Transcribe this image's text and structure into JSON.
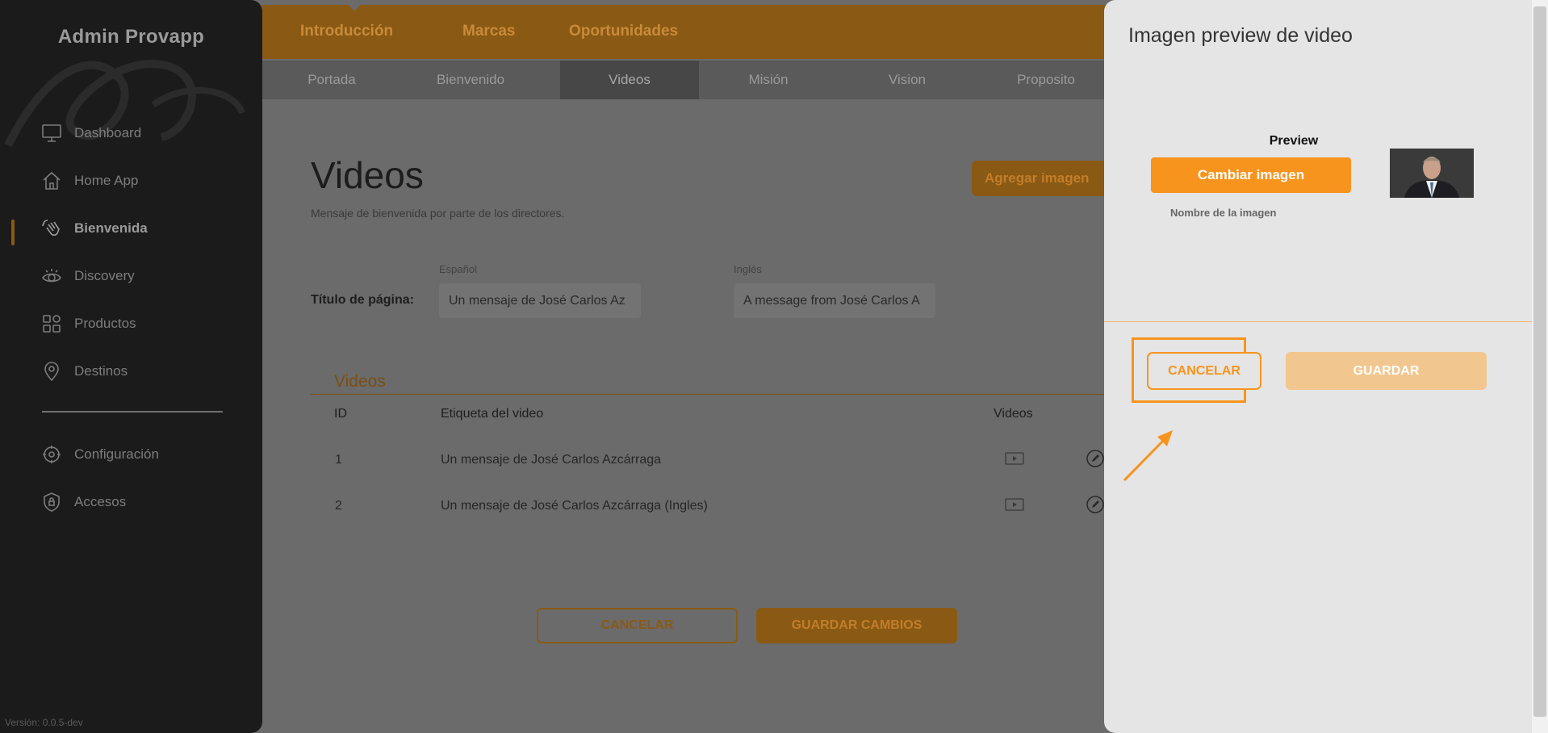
{
  "sidebar": {
    "brand": "Admin Provapp",
    "items": [
      {
        "label": "Dashboard",
        "icon": "monitor-icon"
      },
      {
        "label": "Home App",
        "icon": "home-icon"
      },
      {
        "label": "Bienvenida",
        "icon": "hand-wave-icon",
        "active": true
      },
      {
        "label": "Discovery",
        "icon": "eye-icon"
      },
      {
        "label": "Productos",
        "icon": "grid-icon"
      },
      {
        "label": "Destinos",
        "icon": "map-pin-icon"
      },
      {
        "label": "Configuración",
        "icon": "gear-icon"
      },
      {
        "label": "Accesos",
        "icon": "shield-lock-icon"
      }
    ],
    "version": "Versión: 0.0.5-dev"
  },
  "topnav": {
    "tabs": [
      "Introducción",
      "Marcas",
      "Oportunidades"
    ],
    "subtabs": [
      "Portada",
      "Bienvenido",
      "Videos",
      "Misión",
      "Vision",
      "Proposito"
    ],
    "active_subtab": "Videos"
  },
  "main": {
    "title": "Videos",
    "subtitle": "Mensaje de bienvenida por parte de los directores.",
    "add_button": "Agregar imagen",
    "field_label": "Título de página:",
    "spanish_caption": "Español",
    "english_caption": "Inglés",
    "spanish_value": "Un mensaje de José Carlos Az",
    "english_value": "A message from José Carlos A",
    "section_heading": "Videos",
    "table": {
      "headers": [
        "ID",
        "Etiqueta del video",
        "Videos"
      ],
      "rows": [
        {
          "id": "1",
          "label": "Un mensaje de José Carlos Azcárraga"
        },
        {
          "id": "2",
          "label": "Un mensaje de José Carlos Azcárraga (Ingles)"
        }
      ]
    },
    "cancel_button": "CANCELAR",
    "save_button": "GUARDAR CAMBIOS"
  },
  "modal": {
    "title": "Imagen preview de video",
    "preview_label": "Preview",
    "change_button": "Cambiar imagen",
    "image_name_label": "Nombre de la imagen",
    "cancel_button": "CANCELAR",
    "save_button": "GUARDAR"
  },
  "colors": {
    "accent": "#f7941d",
    "accent_dim": "#8a5a14",
    "sidebar_bg": "#1b1b1b",
    "panel_bg": "#e5e5e5"
  }
}
